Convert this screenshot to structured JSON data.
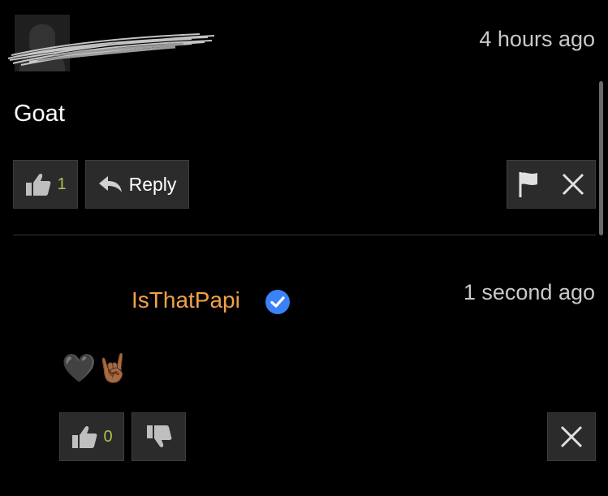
{
  "comment": {
    "timestamp": "4 hours ago",
    "text": "Goat",
    "like_count": "1",
    "reply_label": "Reply"
  },
  "reply": {
    "username": "IsThatPapi",
    "timestamp": "1 second ago",
    "emoji": "🖤🤘🏾",
    "like_count": "0"
  },
  "icons": {
    "like": "thumbs-up-icon",
    "dislike": "thumbs-down-icon",
    "reply": "reply-arrow-icon",
    "flag": "flag-icon",
    "close": "close-icon",
    "verified": "verified-badge-icon"
  },
  "colors": {
    "background": "#000000",
    "username": "#f0a04b",
    "count": "#a8c44a",
    "button_bg": "#2b2b2b",
    "verified": "#3b82f6"
  }
}
